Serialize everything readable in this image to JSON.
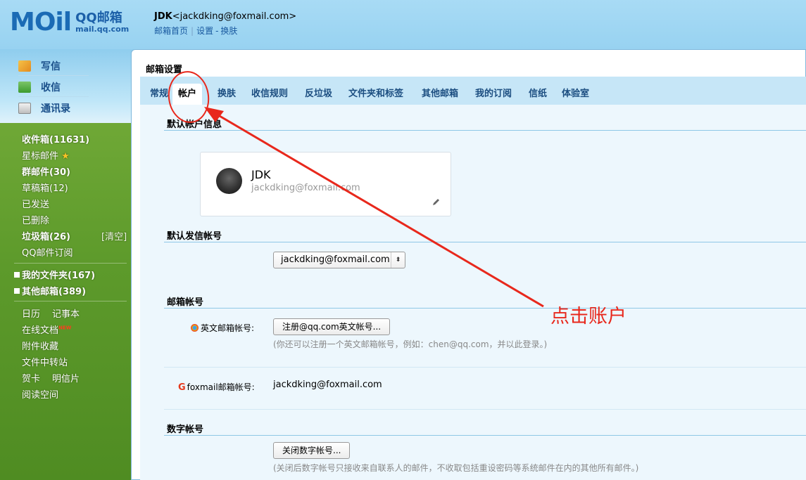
{
  "header": {
    "logo_text": "MOil",
    "brand_cn": "QQ邮箱",
    "brand_en": "mail.qq.com",
    "user_name": "JDK",
    "user_email": "<jackdking@foxmail.com>",
    "link_home": "邮箱首页",
    "link_settings": "设置",
    "link_skin": "换肤",
    "sep": "|",
    "dash": "-"
  },
  "sidebar": {
    "compose": "写信",
    "receive": "收信",
    "contacts": "通讯录",
    "folders": {
      "inbox": "收件箱(11631)",
      "starred": "星标邮件",
      "group": "群邮件(30)",
      "drafts": "草稿箱(12)",
      "sent": "已发送",
      "deleted": "已删除",
      "spam": "垃圾箱(26)",
      "spam_clear": "[清空]",
      "subscriptions": "QQ邮件订阅"
    },
    "my_folders": "我的文件夹(167)",
    "other_mailboxes": "其他邮箱(389)",
    "tools": {
      "calendar": "日历",
      "notes": "记事本",
      "docs": "在线文档",
      "docs_badge": "NEW",
      "attachments": "附件收藏",
      "transfer": "文件中转站",
      "cards": "贺卡",
      "postcards": "明信片",
      "reading": "阅读空间"
    }
  },
  "main": {
    "title": "邮箱设置",
    "tabs": [
      "常规",
      "帐户",
      "换肤",
      "收信规则",
      "反垃圾",
      "文件夹和标签",
      "其他邮箱",
      "我的订阅",
      "信纸",
      "体验室"
    ],
    "active_tab": "帐户",
    "default_account_title": "默认帐户信息",
    "card": {
      "name": "JDK",
      "email": "jackdking@foxmail.com"
    },
    "default_send_title": "默认发信帐号",
    "default_send_value": "jackdking@foxmail.com",
    "mailbox_accounts_title": "邮箱帐号",
    "english_label": "英文邮箱帐号:",
    "english_button": "注册@qq.com英文帐号...",
    "english_hint": "(你还可以注册一个英文邮箱帐号，例如：chen@qq.com，并以此登录。)",
    "foxmail_label": "foxmail邮箱帐号:",
    "foxmail_value": "jackdking@foxmail.com",
    "digital_title": "数字帐号",
    "digital_button": "关闭数字帐号...",
    "digital_hint": "(关闭后数字帐号只接收来自联系人的邮件，不收取包括重设密码等系统邮件在内的其他所有邮件。)"
  },
  "annotation": {
    "text": "点击账户",
    "color": "#e8281c"
  }
}
